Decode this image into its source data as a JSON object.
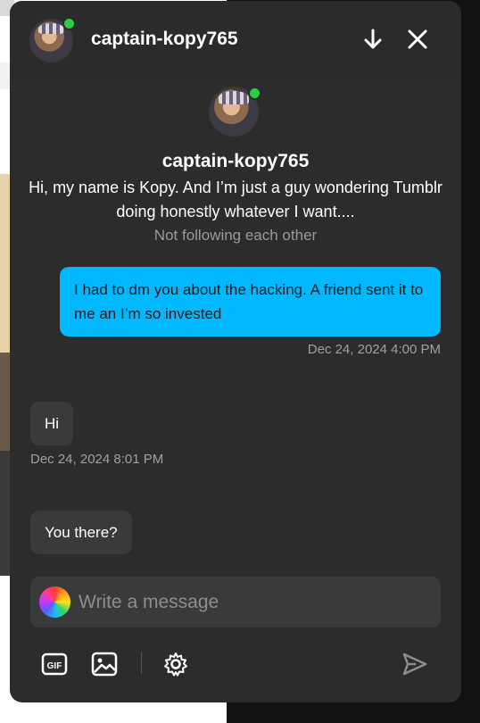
{
  "header": {
    "username": "captain-kopy765",
    "scroll_down_icon": "arrow-down-icon",
    "close_icon": "close-icon"
  },
  "profile": {
    "username": "captain-kopy765",
    "bio": "Hi, my name is Kopy. And I’m just a guy wondering Tumblr doing honestly whatever I want....",
    "follow_status": "Not following each other"
  },
  "messages": [
    {
      "from": "me",
      "text": "I had to dm you about the hacking. A friend sent it to me an I’m so invested",
      "time": "Dec 24, 2024 4:00 PM"
    },
    {
      "from": "them",
      "text": "Hi",
      "time": "Dec 24, 2024 8:01 PM"
    },
    {
      "from": "them",
      "text": "You there?"
    }
  ],
  "composer": {
    "placeholder": "Write a message"
  },
  "toolbar": [
    "gif-icon",
    "image-icon",
    "gear-icon",
    "send-icon"
  ],
  "colors": {
    "panel": "#2c2c2c",
    "sent_bubble": "#00b8ff",
    "received_bubble": "#3a3a3a",
    "online": "#2ecc40"
  }
}
